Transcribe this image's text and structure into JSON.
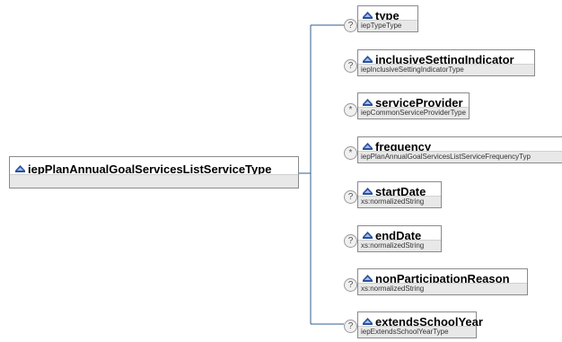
{
  "root": {
    "name": "iepPlanAnnualGoalServicesListServiceType"
  },
  "children": [
    {
      "name": "type",
      "type": "iepTypeType",
      "occurrence": "?"
    },
    {
      "name": "inclusiveSettingIndicator",
      "type": "iepInclusiveSettingIndicatorType",
      "occurrence": "?"
    },
    {
      "name": "serviceProvider",
      "type": "iepCommonServiceProviderType",
      "occurrence": "*"
    },
    {
      "name": "frequency",
      "type": "iepPlanAnnualGoalServicesListServiceFrequencyTyp",
      "occurrence": "*"
    },
    {
      "name": "startDate",
      "type": "xs:normalizedString",
      "occurrence": "?"
    },
    {
      "name": "endDate",
      "type": "xs:normalizedString",
      "occurrence": "?"
    },
    {
      "name": "nonParticipationReason",
      "type": "xs:normalizedString",
      "occurrence": "?"
    },
    {
      "name": "extendsSchoolYear",
      "type": "iepExtendsSchoolYearType",
      "occurrence": "?"
    }
  ],
  "colors": {
    "icon": "#2a4f9c",
    "line": "#2f5f8f"
  }
}
